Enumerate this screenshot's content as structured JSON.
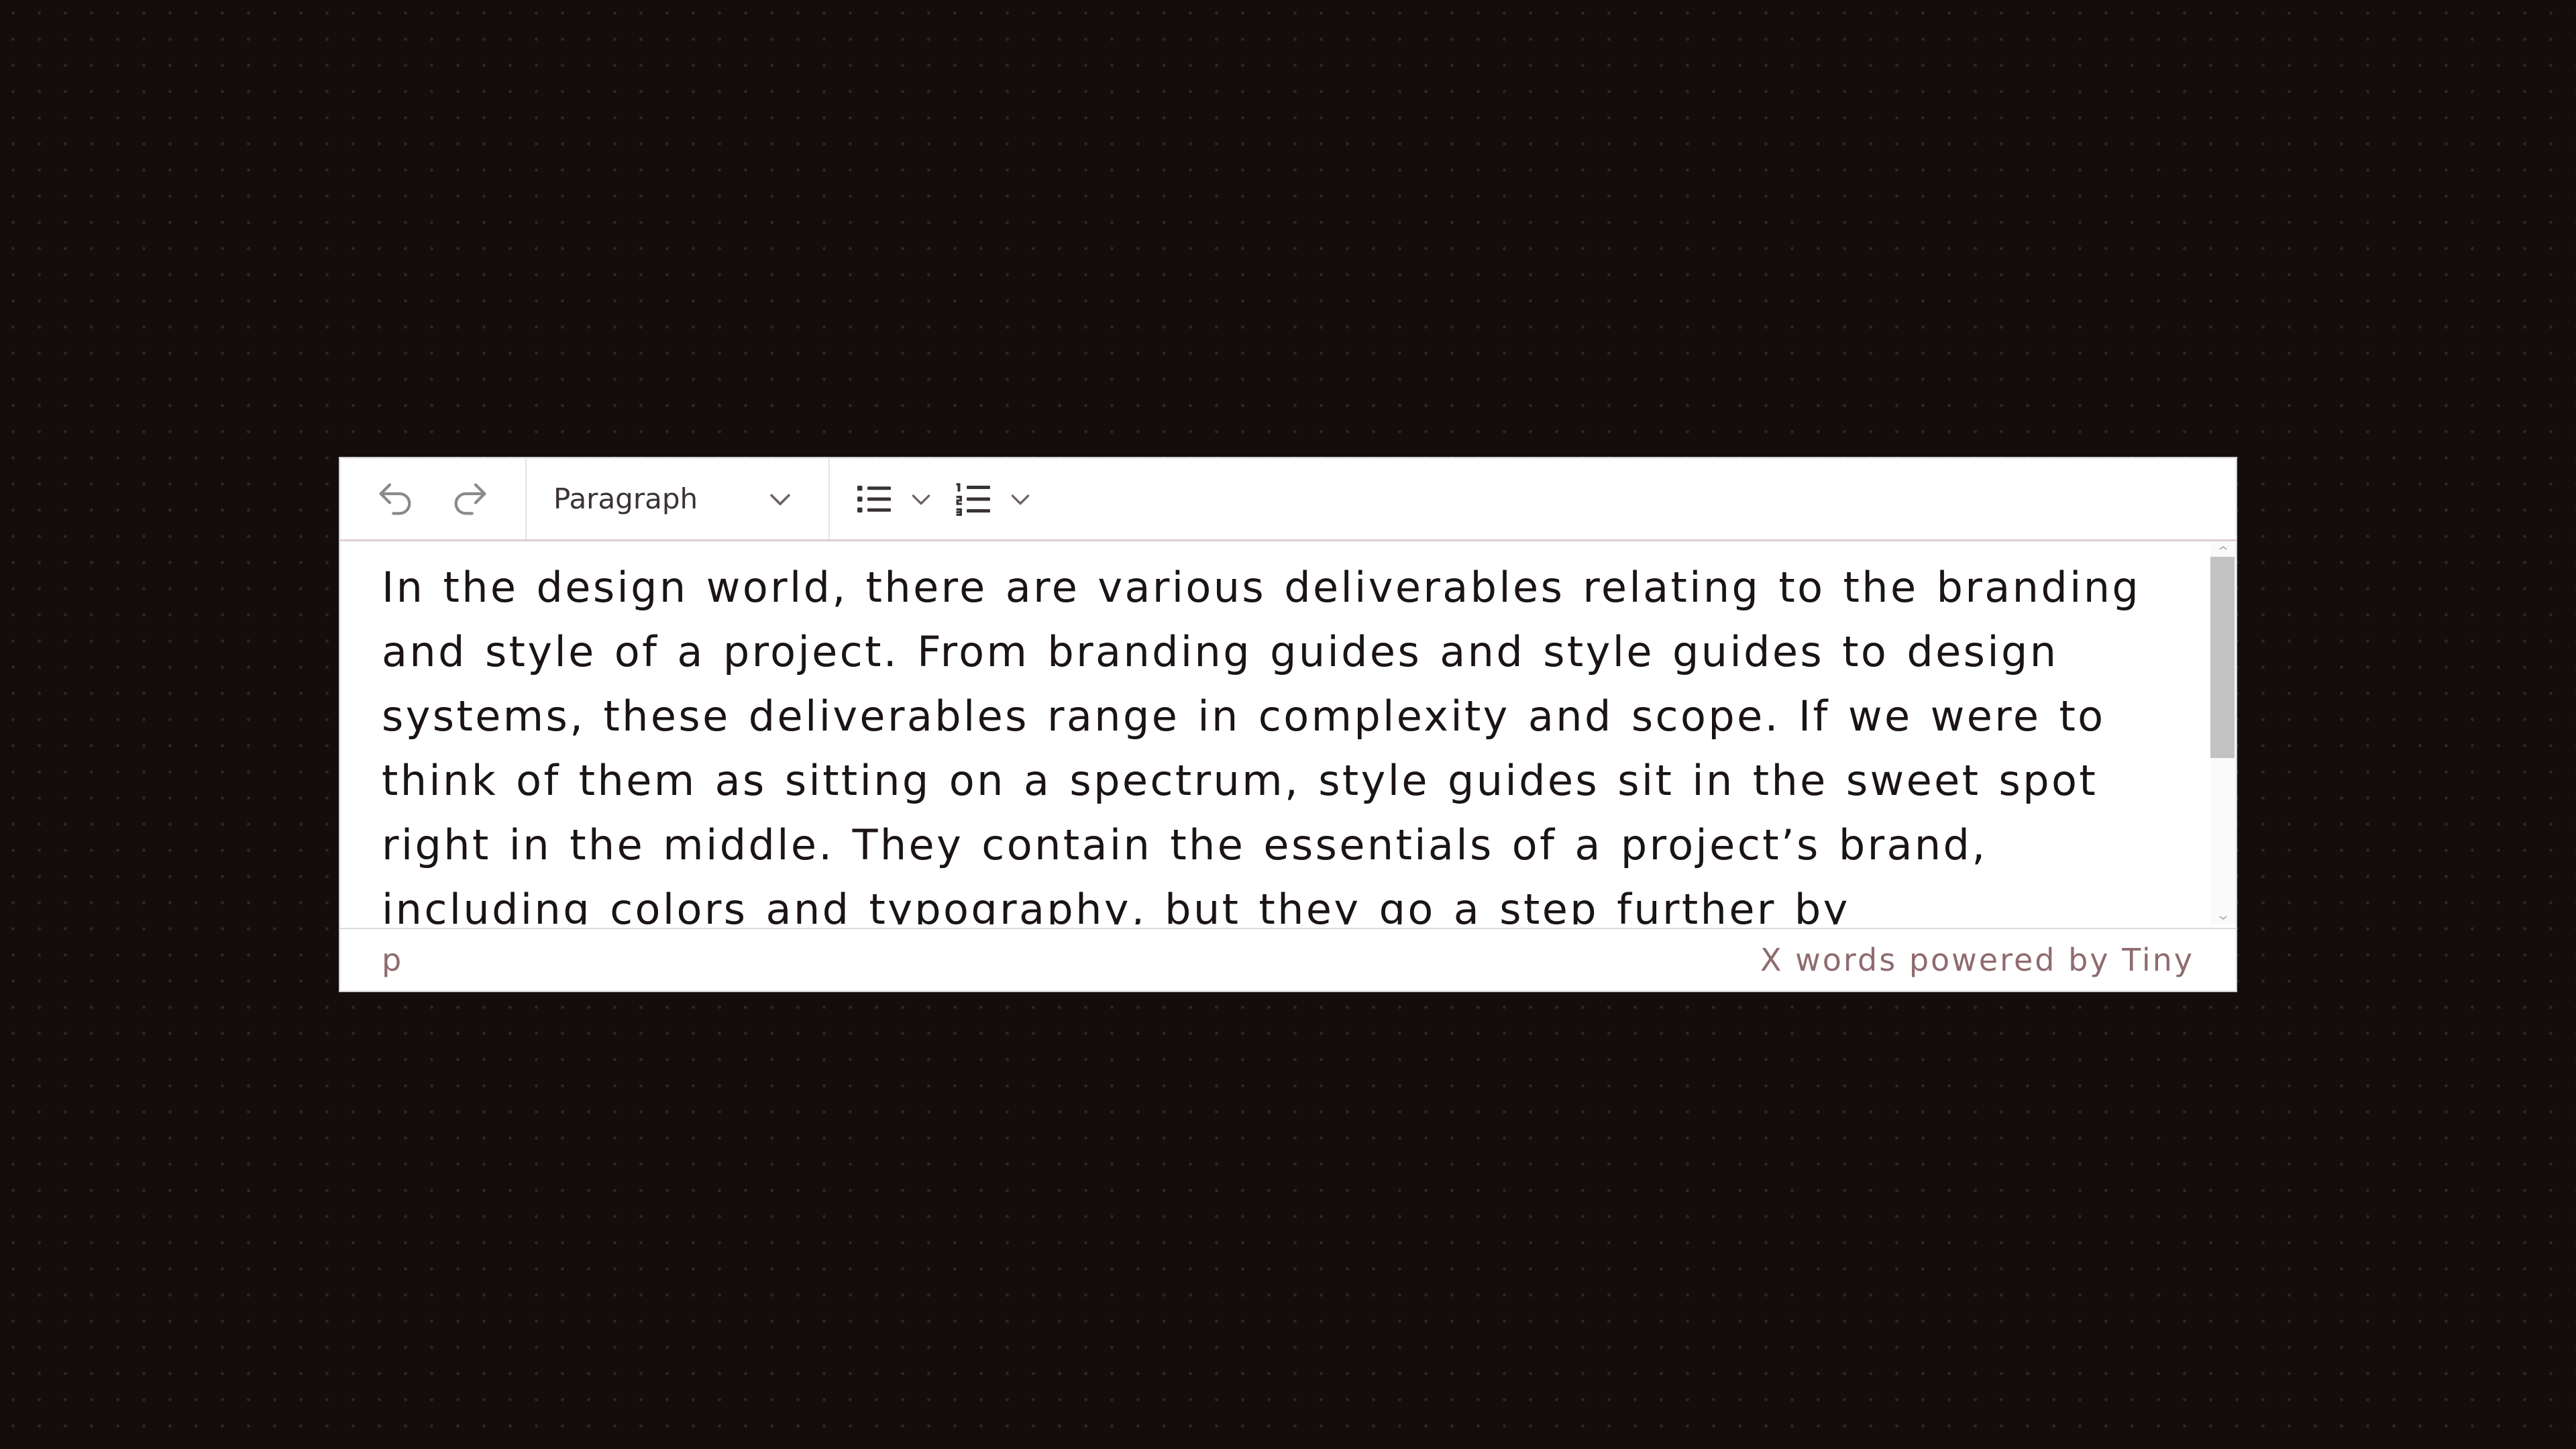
{
  "colors": {
    "background": "#140d0e",
    "editor_bg": "#ffffff",
    "toolbar_border": "#dccfd2",
    "text": "#1b1414",
    "statusbar_text": "#8f6b6f",
    "icon_active": "#3a3333",
    "icon_disabled": "#8a8a8a"
  },
  "toolbar": {
    "undo_icon": "undo-icon",
    "redo_icon": "redo-icon",
    "block_format": {
      "selected": "Paragraph"
    },
    "bullet_list_icon": "bullet-list-icon",
    "numbered_list_icon": "numbered-list-icon"
  },
  "content": {
    "paragraph": "In the design world, there are various deliverables relating to the branding and style of a project. From branding guides and style guides to design systems, these deliverables range in complexity and scope. If we were to think of them as sitting on a spectrum, style guides sit in the sweet spot right in the middle. They contain the essentials of a project’s brand, including colors and typography, but they go a step further by"
  },
  "statusbar": {
    "path": "p",
    "info": "X words powered by Tiny"
  }
}
